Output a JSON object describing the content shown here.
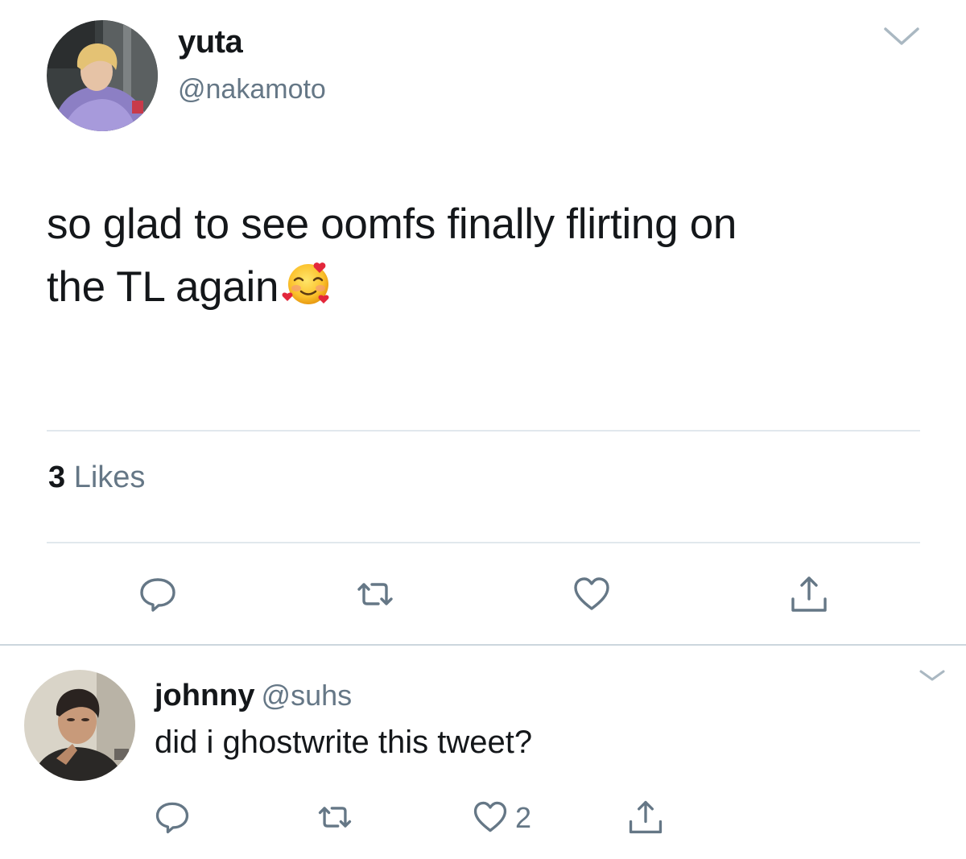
{
  "tweet": {
    "display_name": "yuta",
    "handle": "@nakamoto",
    "text_line1": "so glad to see oomfs finally flirting on",
    "text_line2": "the TL again",
    "emoji": "smiling-face-with-hearts",
    "likes_count": "3",
    "likes_label": "Likes"
  },
  "reply": {
    "display_name": "johnny",
    "handle": "@suhs",
    "text": "did i ghostwrite this tweet?",
    "like_count": "2"
  },
  "colors": {
    "text_primary": "#14171a",
    "text_secondary": "#657786",
    "divider": "#e1e8ed",
    "icon": "#657786"
  },
  "icons": [
    "chevron-down-icon",
    "reply-icon",
    "retweet-icon",
    "heart-icon",
    "share-icon"
  ]
}
